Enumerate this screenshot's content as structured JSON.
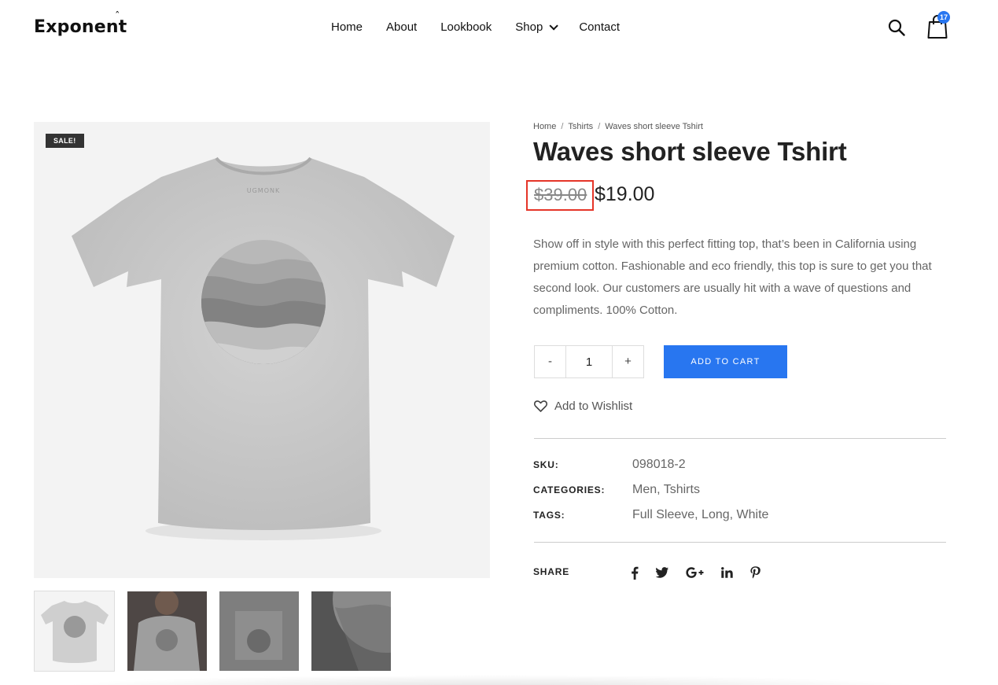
{
  "header": {
    "logo": "Exponent",
    "nav": [
      {
        "label": "Home"
      },
      {
        "label": "About"
      },
      {
        "label": "Lookbook"
      },
      {
        "label": "Shop"
      },
      {
        "label": "Contact"
      }
    ],
    "cart_count": "17",
    "icons": {
      "search": "search-icon",
      "cart": "shopping-bag-icon"
    }
  },
  "product": {
    "sale_badge": "SALE!",
    "breadcrumb": [
      "Home",
      "Tshirts",
      "Waves short sleeve Tshirt"
    ],
    "breadcrumb_sep": "/",
    "title": "Waves short sleeve Tshirt",
    "price_old": "$39.00",
    "price_new": "$19.00",
    "description": "Show off in style with this perfect fitting top, that’s been in California using premium cotton. Fashionable and eco friendly, this top is sure to get you that second look. Our customers are usually hit with a wave of questions and compliments. 100% Cotton.",
    "quantity": "1",
    "qty_minus": "-",
    "qty_plus": "+",
    "add_to_cart": "ADD TO CART",
    "wishlist": "Add to Wishlist",
    "meta": {
      "sku_label": "SKU:",
      "sku": "098018-2",
      "categories_label": "CATEGORIES:",
      "categories": "Men, Tshirts",
      "tags_label": "TAGS:",
      "tags": "Full Sleeve, Long, White"
    },
    "share_label": "SHARE",
    "share_icons": [
      "facebook-icon",
      "twitter-icon",
      "google-plus-icon",
      "linkedin-icon",
      "pinterest-icon"
    ],
    "shirt_print": "UGMONK",
    "colors": {
      "accent": "#2876f0",
      "highlight_box": "#e53528",
      "badge": "#333333"
    }
  }
}
